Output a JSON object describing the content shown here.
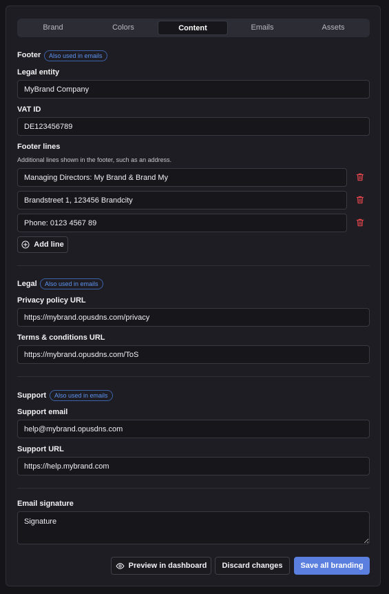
{
  "tabs": [
    {
      "label": "Brand",
      "active": false
    },
    {
      "label": "Colors",
      "active": false
    },
    {
      "label": "Content",
      "active": true
    },
    {
      "label": "Emails",
      "active": false
    },
    {
      "label": "Assets",
      "active": false
    }
  ],
  "badge_text": "Also used in emails",
  "footer": {
    "title": "Footer",
    "legal_entity": {
      "label": "Legal entity",
      "value": "MyBrand Company"
    },
    "vat_id": {
      "label": "VAT ID",
      "value": "DE123456789"
    },
    "footer_lines": {
      "label": "Footer lines",
      "help": "Additional lines shown in the footer, such as an address.",
      "lines": [
        "Managing Directors: My Brand & Brand My",
        "Brandstreet 1, 123456 Brandcity",
        "Phone: 0123 4567 89"
      ],
      "add_label": "Add line"
    }
  },
  "legal": {
    "title": "Legal",
    "privacy": {
      "label": "Privacy policy URL",
      "value": "https://mybrand.opusdns.com/privacy"
    },
    "terms": {
      "label": "Terms & conditions URL",
      "value": "https://mybrand.opusdns.com/ToS"
    }
  },
  "support": {
    "title": "Support",
    "email": {
      "label": "Support email",
      "value": "help@mybrand.opusdns.com"
    },
    "url": {
      "label": "Support URL",
      "value": "https://help.mybrand.com"
    }
  },
  "signature": {
    "label": "Email signature",
    "value": "Signature"
  },
  "actions": {
    "preview": "Preview in dashboard",
    "discard": "Discard changes",
    "save": "Save all branding"
  },
  "colors": {
    "accent": "#5a7fdf",
    "danger": "#e0454b",
    "badge": "#5f93f0"
  }
}
